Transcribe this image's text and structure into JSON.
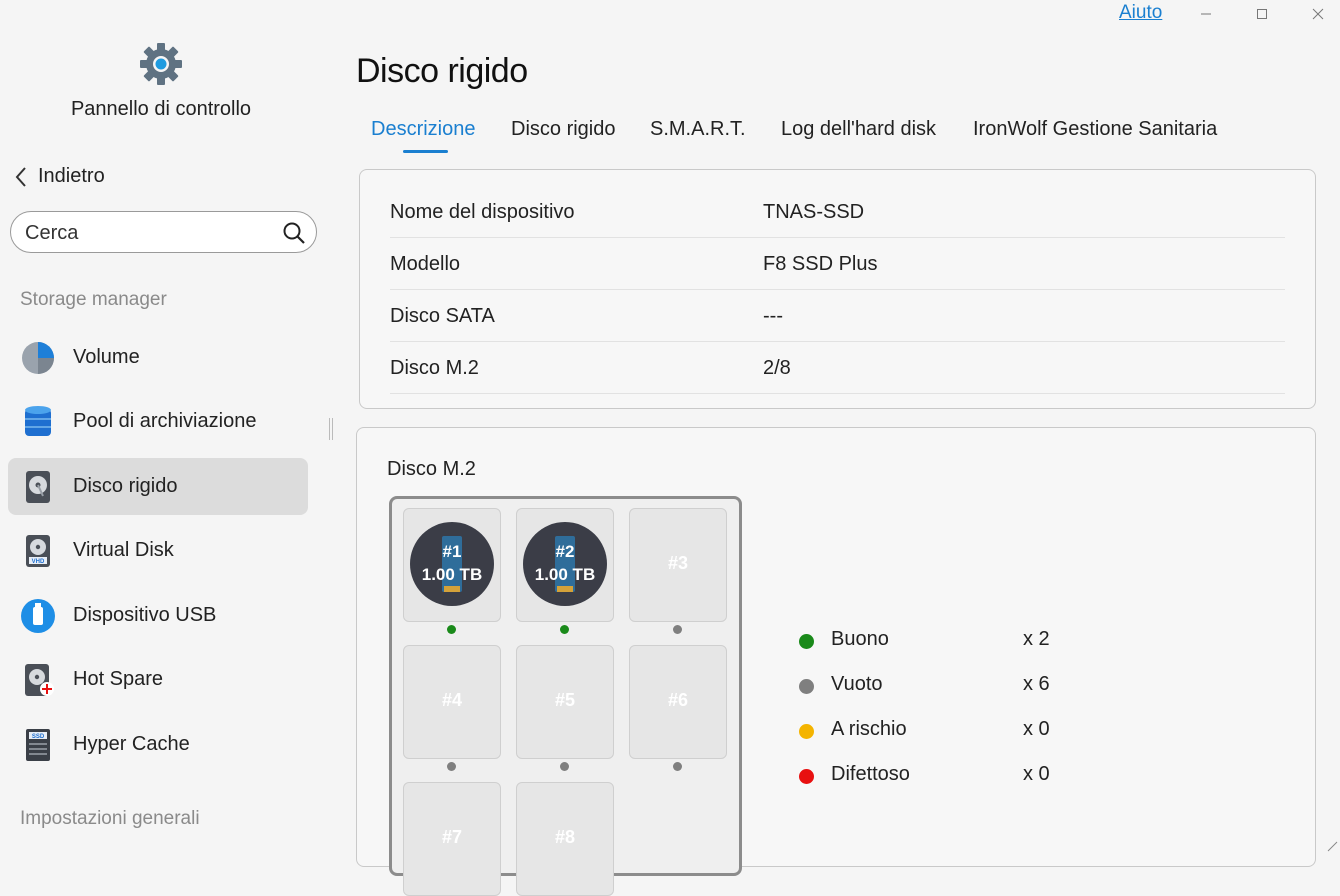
{
  "titlebar": {
    "help": "Aiuto"
  },
  "sidebar": {
    "app_title": "Pannello di controllo",
    "back": "Indietro",
    "search_placeholder": "Cerca",
    "section_storage": "Storage manager",
    "items": [
      {
        "label": "Volume",
        "icon": "volume-pie-icon"
      },
      {
        "label": "Pool di archiviazione",
        "icon": "storage-pool-icon"
      },
      {
        "label": "Disco rigido",
        "icon": "hard-disk-icon",
        "active": true
      },
      {
        "label": "Virtual Disk",
        "icon": "virtual-disk-icon"
      },
      {
        "label": "Dispositivo USB",
        "icon": "usb-device-icon"
      },
      {
        "label": "Hot Spare",
        "icon": "hot-spare-icon"
      },
      {
        "label": "Hyper Cache",
        "icon": "ssd-cache-icon"
      }
    ],
    "section_general": "Impostazioni generali"
  },
  "main": {
    "title": "Disco rigido",
    "tabs": [
      "Descrizione",
      "Disco rigido",
      "S.M.A.R.T.",
      "Log dell'hard disk",
      "IronWolf Gestione Sanitaria"
    ],
    "active_tab": 0,
    "info": [
      {
        "key": "Nome del dispositivo",
        "value": "TNAS-SSD"
      },
      {
        "key": "Modello",
        "value": "F8 SSD Plus"
      },
      {
        "key": "Disco SATA",
        "value": "---"
      },
      {
        "key": "Disco M.2",
        "value": "2/8"
      }
    ],
    "disk_panel": {
      "title": "Disco M.2",
      "slots": [
        {
          "label": "#1",
          "size": "1.00 TB",
          "status": "good"
        },
        {
          "label": "#2",
          "size": "1.00 TB",
          "status": "good"
        },
        {
          "label": "#3",
          "status": "empty"
        },
        {
          "label": "#4",
          "status": "empty"
        },
        {
          "label": "#5",
          "status": "empty"
        },
        {
          "label": "#6",
          "status": "empty"
        },
        {
          "label": "#7",
          "status": "empty"
        },
        {
          "label": "#8",
          "status": "empty"
        }
      ],
      "legend": [
        {
          "name": "Buono",
          "count": "x 2",
          "color": "#1a8a1a"
        },
        {
          "name": "Vuoto",
          "count": "x 6",
          "color": "#7f7f7f"
        },
        {
          "name": "A rischio",
          "count": "x 0",
          "color": "#f4b400"
        },
        {
          "name": "Difettoso",
          "count": "x 0",
          "color": "#e81010"
        }
      ]
    }
  }
}
